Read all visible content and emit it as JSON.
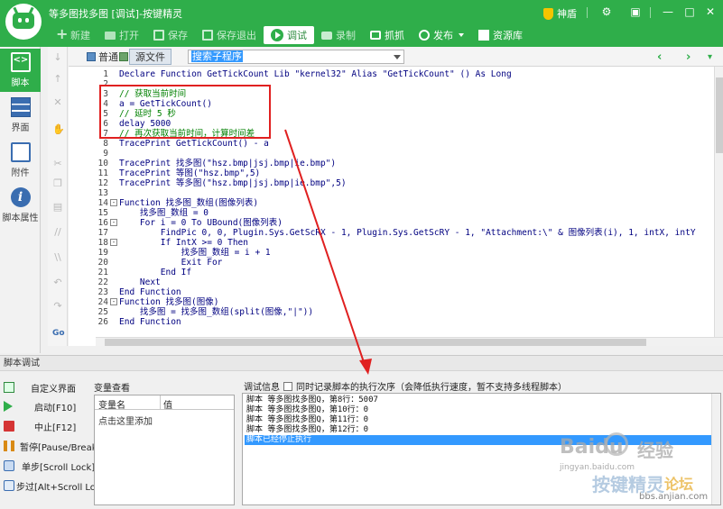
{
  "window": {
    "title": "等多图找多图 [调试]-按键精灵",
    "shield_label": "神盾"
  },
  "toolbar": [
    {
      "label": "新建",
      "icon": "plus-icon"
    },
    {
      "label": "打开",
      "icon": "folder-icon"
    },
    {
      "label": "保存",
      "icon": "disk-icon"
    },
    {
      "label": "保存退出",
      "icon": "disk-icon"
    },
    {
      "label": "调试",
      "icon": "play-icon"
    },
    {
      "label": "录制",
      "icon": "record-icon"
    },
    {
      "label": "抓抓",
      "icon": "capture-icon"
    },
    {
      "label": "发布",
      "icon": "publish-icon"
    },
    {
      "label": "资源库",
      "icon": "library-icon"
    }
  ],
  "sidenav": [
    {
      "label": "脚本",
      "icon": "script-icon"
    },
    {
      "label": "界面",
      "icon": "ui-icon"
    },
    {
      "label": "附件",
      "icon": "attachment-icon"
    },
    {
      "label": "脚本属性",
      "icon": "info-icon"
    }
  ],
  "editor_header": {
    "tab_normal": "普通",
    "tab_source": "源文件",
    "proc_select": "搜索子程序"
  },
  "code": [
    {
      "n": "1",
      "t": "Declare Function GetTickCount Lib \"kernel32\" Alias \"GetTickCount\" () As Long",
      "c": false,
      "fold": ""
    },
    {
      "n": "2",
      "t": "",
      "c": false,
      "fold": ""
    },
    {
      "n": "3",
      "t": "// 获取当前时间",
      "c": true,
      "fold": ""
    },
    {
      "n": "4",
      "t": "a = GetTickCount()",
      "c": false,
      "fold": ""
    },
    {
      "n": "5",
      "t": "// 延时 5 秒",
      "c": true,
      "fold": ""
    },
    {
      "n": "6",
      "t": "delay 5000",
      "c": false,
      "fold": ""
    },
    {
      "n": "7",
      "t": "// 再次获取当前时间，计算时间差",
      "c": true,
      "fold": ""
    },
    {
      "n": "8",
      "t": "TracePrint GetTickCount() - a",
      "c": false,
      "fold": ""
    },
    {
      "n": "9",
      "t": "",
      "c": false,
      "fold": ""
    },
    {
      "n": "10",
      "t": "TracePrint 找多图(\"hsz.bmp|jsj.bmp|ie.bmp\")",
      "c": false,
      "fold": ""
    },
    {
      "n": "11",
      "t": "TracePrint 等图(\"hsz.bmp\",5)",
      "c": false,
      "fold": ""
    },
    {
      "n": "12",
      "t": "TracePrint 等多图(\"hsz.bmp|jsj.bmp|ie.bmp\",5)",
      "c": false,
      "fold": ""
    },
    {
      "n": "13",
      "t": "",
      "c": false,
      "fold": ""
    },
    {
      "n": "14",
      "t": "Function 找多图_数组(图像列表)",
      "c": false,
      "fold": "-"
    },
    {
      "n": "15",
      "t": "    找多图_数组 = 0",
      "c": false,
      "fold": ""
    },
    {
      "n": "16",
      "t": "    For i = 0 To UBound(图像列表)",
      "c": false,
      "fold": "-"
    },
    {
      "n": "17",
      "t": "        FindPic 0, 0, Plugin.Sys.GetScRX - 1, Plugin.Sys.GetScRY - 1, \"Attachment:\\\" & 图像列表(i), 1, intX, intY",
      "c": false,
      "fold": ""
    },
    {
      "n": "18",
      "t": "        If IntX >= 0 Then",
      "c": false,
      "fold": "-"
    },
    {
      "n": "19",
      "t": "            找多图_数组 = i + 1",
      "c": false,
      "fold": ""
    },
    {
      "n": "20",
      "t": "            Exit For",
      "c": false,
      "fold": ""
    },
    {
      "n": "21",
      "t": "        End If",
      "c": false,
      "fold": ""
    },
    {
      "n": "22",
      "t": "    Next",
      "c": false,
      "fold": ""
    },
    {
      "n": "23",
      "t": "End Function",
      "c": false,
      "fold": ""
    },
    {
      "n": "24",
      "t": "Function 找多图(图像)",
      "c": false,
      "fold": "-"
    },
    {
      "n": "25",
      "t": "    找多图 = 找多图_数组(split(图像,\"|\"))",
      "c": false,
      "fold": ""
    },
    {
      "n": "26",
      "t": "End Function",
      "c": false,
      "fold": ""
    }
  ],
  "debug": {
    "panel_title": "脚本调试",
    "buttons": [
      {
        "label": "自定义界面",
        "icon": "custom-ui-icon"
      },
      {
        "label": "启动[F10]",
        "icon": "start-icon"
      },
      {
        "label": "中止[F12]",
        "icon": "stop-icon"
      },
      {
        "label": "暂停[Pause/Break]",
        "icon": "pause-icon"
      },
      {
        "label": "单步[Scroll Lock]",
        "icon": "step-icon"
      },
      {
        "label": "步过[Alt+Scroll Lock]",
        "icon": "step-over-icon"
      }
    ],
    "var_title": "变量查看",
    "var_col_name": "变量名",
    "var_col_value": "值",
    "var_add": "点击这里添加",
    "info_label": "调试信息",
    "record_option": "同时记录脚本的执行次序（会降低执行速度，暂不支持多线程脚本）",
    "output": [
      {
        "text": "脚本 等多图找多图Q，第8行：5007",
        "selected": false
      },
      {
        "text": "脚本 等多图找多图Q，第10行：0",
        "selected": false
      },
      {
        "text": "脚本 等多图找多图Q，第11行：0",
        "selected": false
      },
      {
        "text": "脚本 等多图找多图Q，第12行：0",
        "selected": false
      },
      {
        "text": "脚本已经停止执行",
        "selected": true
      }
    ]
  },
  "watermark": {
    "brand": "Baidu",
    "brand2": "经验",
    "url": "jingyan.baidu.com",
    "forum": "按键精灵",
    "forum2": "论坛",
    "forum_url": "bbs.anjian.com"
  },
  "colors": {
    "brand_green": "#2fae4a",
    "highlight_red": "#e02020",
    "selection_blue": "#3399ff",
    "comment_green": "#008000",
    "code_navy": "#000080"
  }
}
